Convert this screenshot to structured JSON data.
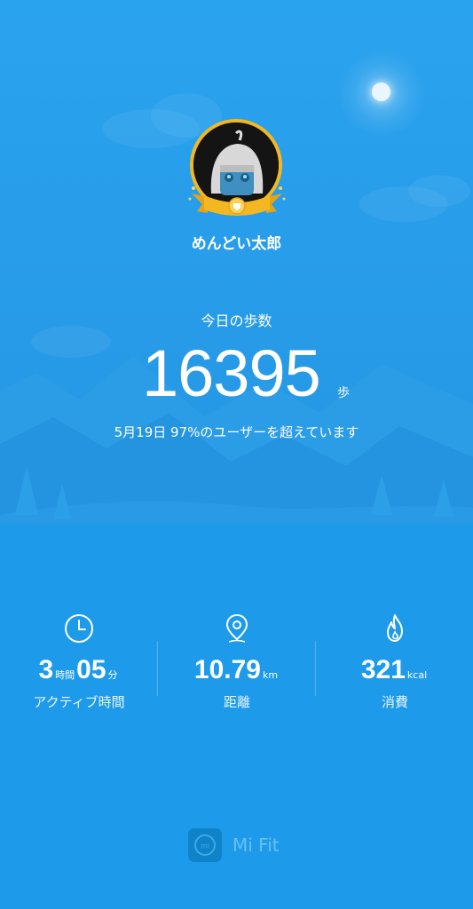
{
  "profile": {
    "username": "めんどい太郎"
  },
  "steps": {
    "label": "今日の歩数",
    "value": "16395",
    "unit": "歩",
    "comparison": "5月19日 97%のユーザーを超えています"
  },
  "stats": {
    "active": {
      "hours": "3",
      "hours_unit": "時間",
      "minutes": "05",
      "minutes_unit": "分",
      "label": "アクティブ時間",
      "icon": "clock-icon"
    },
    "distance": {
      "value": "10.79",
      "unit": "km",
      "label": "距離",
      "icon": "location-pin-icon"
    },
    "calories": {
      "value": "321",
      "unit": "kcal",
      "label": "消費",
      "icon": "flame-icon"
    }
  },
  "brand": {
    "name": "Mi Fit",
    "icon": "mi-logo-icon"
  },
  "colors": {
    "background": "#1e9be8",
    "badge_gold": "#f3b821"
  }
}
